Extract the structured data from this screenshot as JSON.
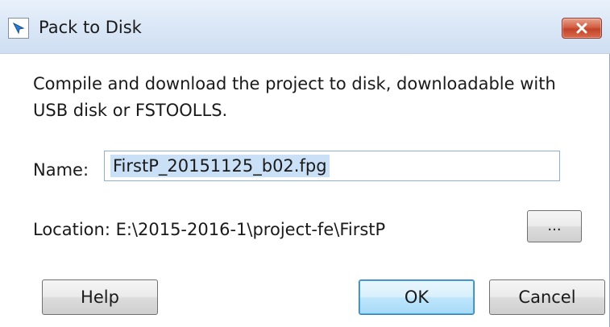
{
  "window": {
    "title": "Pack to Disk",
    "app_icon": "dialog-app-icon",
    "close_icon": "close-icon"
  },
  "message": "Compile and download the project to disk, downloadable with USB disk or FSTOOLLS.",
  "name_field": {
    "label": "Name:",
    "value": "FirstP_20151125_b02.fpg"
  },
  "location": {
    "label": "Location:",
    "path": "E:\\2015-2016-1\\project-fe\\FirstP",
    "text": "Location: E:\\2015-2016-1\\project-fe\\FirstP",
    "browse_label": "..."
  },
  "buttons": {
    "help": "Help",
    "ok": "OK",
    "cancel": "Cancel"
  },
  "colors": {
    "titlebar": "#d9e6f6",
    "close_button": "#c2442a",
    "default_button_border": "#3c7fb1",
    "input_border": "#8fb0d6",
    "selection": "#c9e0f7"
  }
}
